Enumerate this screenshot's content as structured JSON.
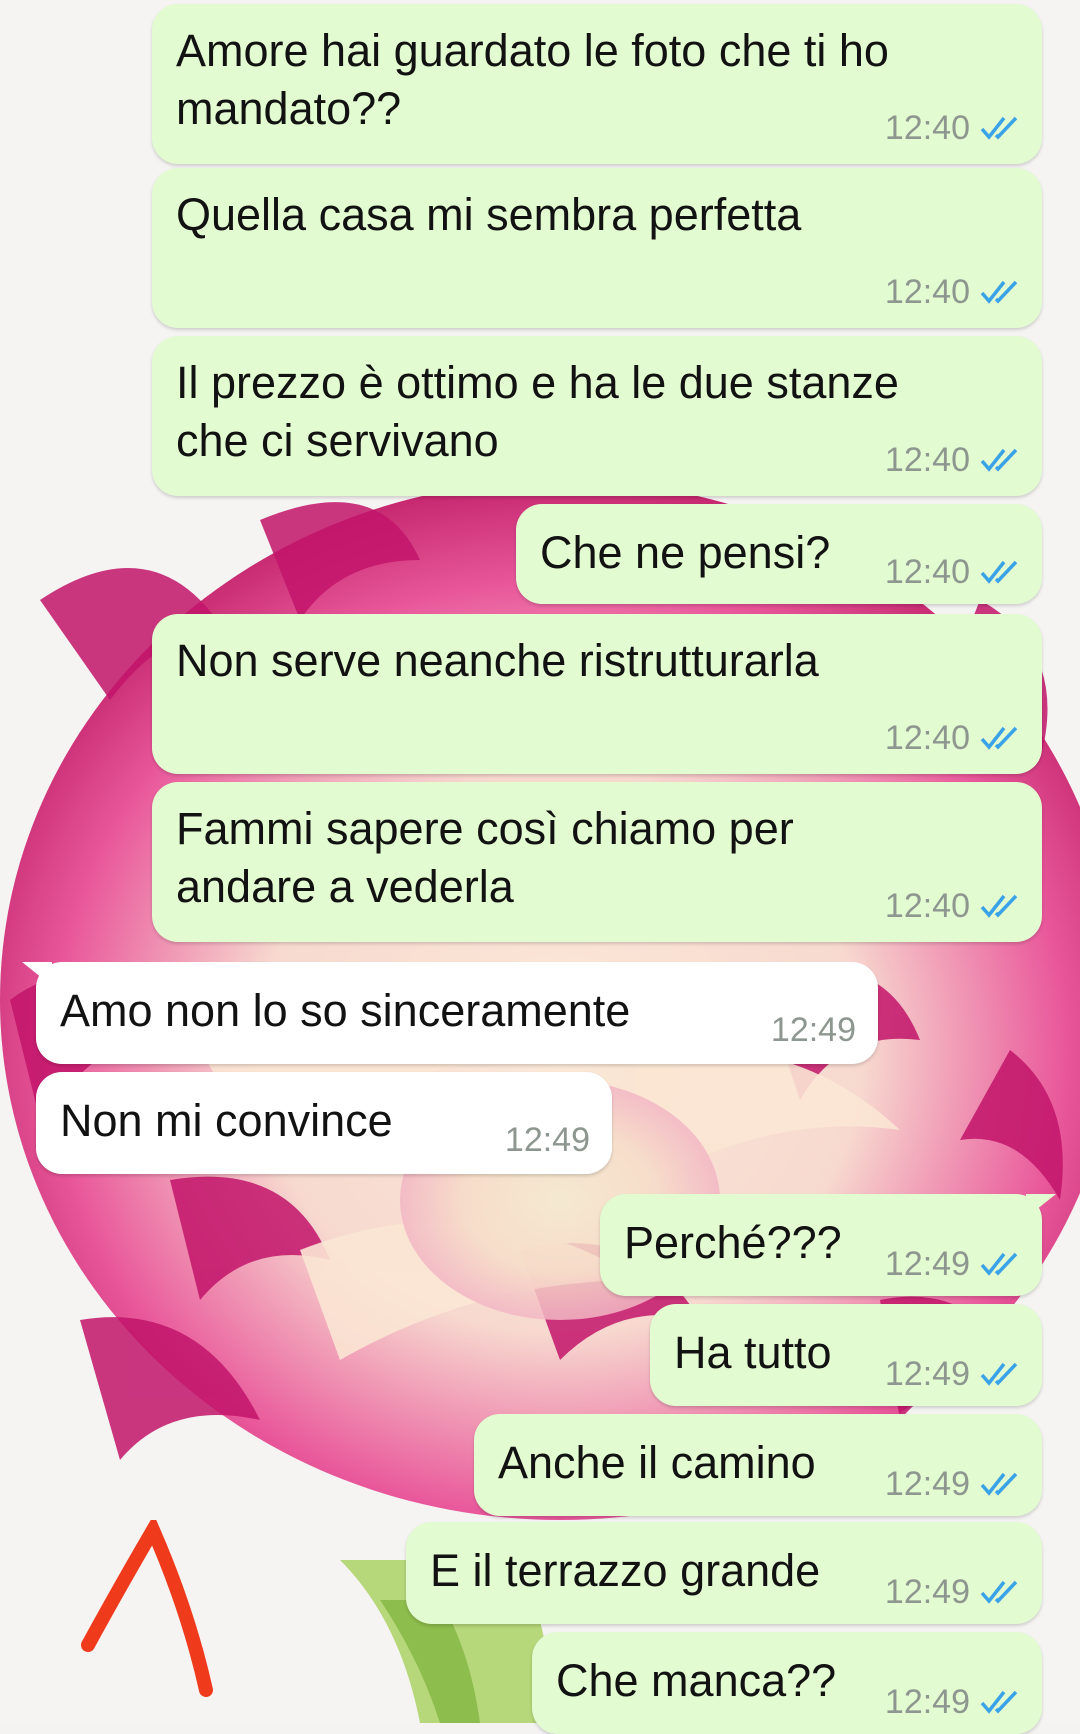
{
  "conversation": {
    "colors": {
      "outgoing_bubble": "#e3fbd0",
      "incoming_bubble": "#ffffff",
      "read_tick": "#3aa3e8",
      "annotation_arrow": "#ef3a1c"
    },
    "messages": [
      {
        "direction": "outgoing",
        "text": "Amore hai guardato le foto che ti ho\nmandato??",
        "time": "12:40",
        "status": "read-double-tick-icon"
      },
      {
        "direction": "outgoing",
        "text": "Quella casa mi sembra perfetta",
        "time": "12:40",
        "status": "read-double-tick-icon"
      },
      {
        "direction": "outgoing",
        "text": "Il prezzo è ottimo e ha le due stanze\nche ci servivano",
        "time": "12:40",
        "status": "read-double-tick-icon"
      },
      {
        "direction": "outgoing",
        "text": "Che ne pensi?",
        "time": "12:40",
        "status": "read-double-tick-icon"
      },
      {
        "direction": "outgoing",
        "text": "Non serve neanche ristrutturarla",
        "time": "12:40",
        "status": "read-double-tick-icon"
      },
      {
        "direction": "outgoing",
        "text": "Fammi sapere così chiamo per\nandare a vederla",
        "time": "12:40",
        "status": "read-double-tick-icon"
      },
      {
        "direction": "incoming",
        "text": "Amo non lo so sinceramente",
        "time": "12:49"
      },
      {
        "direction": "incoming",
        "text": "Non mi convince",
        "time": "12:49"
      },
      {
        "direction": "outgoing",
        "text": "Perché???",
        "time": "12:49",
        "status": "read-double-tick-icon"
      },
      {
        "direction": "outgoing",
        "text": "Ha tutto",
        "time": "12:49",
        "status": "read-double-tick-icon"
      },
      {
        "direction": "outgoing",
        "text": "Anche il camino",
        "time": "12:49",
        "status": "read-double-tick-icon"
      },
      {
        "direction": "outgoing",
        "text": "E il terrazzo grande",
        "time": "12:49",
        "status": "read-double-tick-icon"
      },
      {
        "direction": "outgoing",
        "text": "Che manca??",
        "time": "12:49",
        "status": "read-double-tick-icon"
      }
    ],
    "wallpaper": "carnation-flower-wallpaper",
    "annotation": "red-caret-arrow-icon"
  }
}
